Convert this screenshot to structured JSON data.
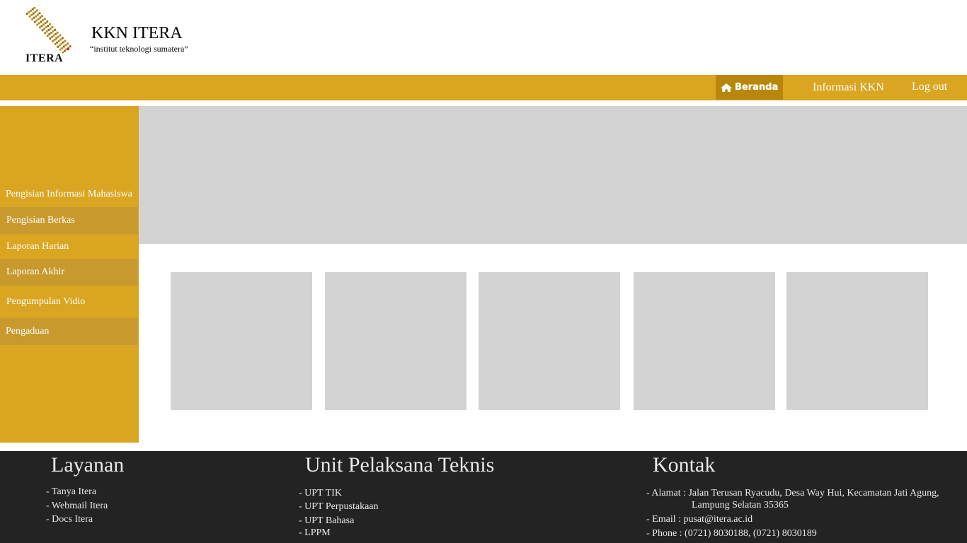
{
  "brand": {
    "logo_text": "ITERA",
    "title": "KKN ITERA",
    "tagline": "“institut teknologi sumatera”",
    "colors": {
      "accent": "#DAA520",
      "accent_dark": "#B8860B",
      "footer_bg": "#232323",
      "placeholder": "#D3D3D3"
    }
  },
  "nav": {
    "home_label": "Beranda",
    "home_icon": "home-icon",
    "info_label": "Informasi KKN",
    "logout_label": "Log out"
  },
  "sidebar": {
    "items": [
      {
        "label": "Pengisian Informasi Mahasiswa"
      },
      {
        "label": "Pengisian Berkas"
      },
      {
        "label": "Laporan Harian"
      },
      {
        "label": "Laporan Akhir"
      },
      {
        "label": "Pengumpulan Vidio"
      },
      {
        "label": "Pengaduan"
      }
    ]
  },
  "footer": {
    "layanan": {
      "heading": "Layanan",
      "items": [
        "- Tanya Itera",
        "- Webmail Itera",
        "- Docs Itera"
      ]
    },
    "upt": {
      "heading": "Unit Pelaksana Teknis",
      "items": [
        "- UPT TIK",
        "- UPT Perpustakaan",
        "- UPT Bahasa",
        "- LPPM"
      ]
    },
    "kontak": {
      "heading": "Kontak",
      "address_line1": "- Alamat : Jalan Terusan Ryacudu, Desa Way Hui, Kecamatan Jati Agung,",
      "address_line2": "Lampung Selatan 35365",
      "email": "- Email : pusat@itera.ac.id",
      "phone": "- Phone : (0721) 8030188, (0721) 8030189"
    }
  }
}
